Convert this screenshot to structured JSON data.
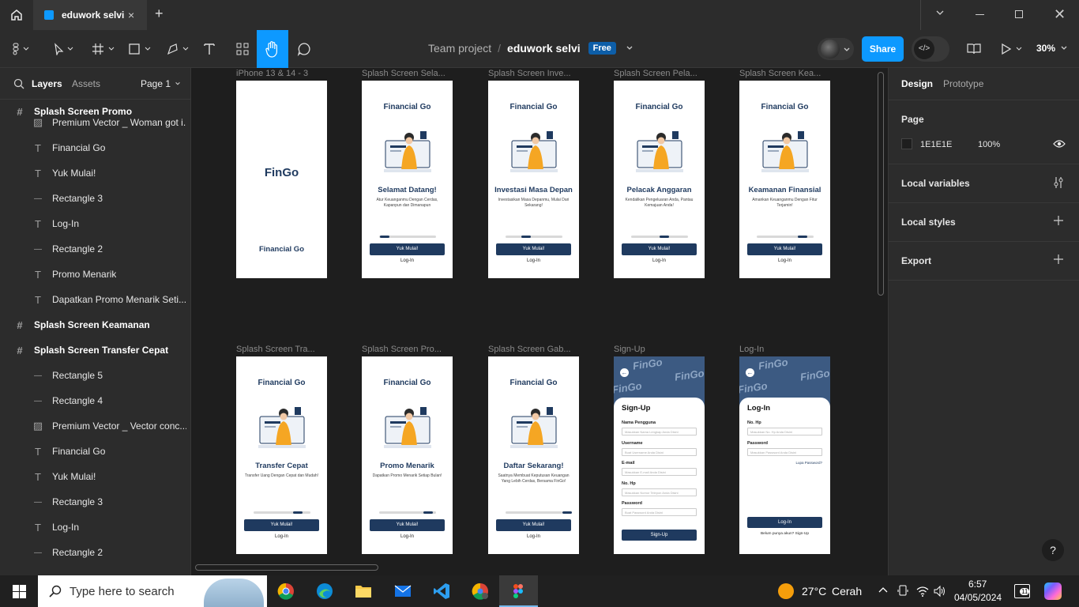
{
  "titlebar": {
    "tab_title": "eduwork selvi",
    "add_tab": "+"
  },
  "toolbar": {
    "breadcrumb_project": "Team project",
    "breadcrumb_sep": "/",
    "file_name": "eduwork selvi",
    "plan_badge": "Free",
    "share_label": "Share",
    "zoom": "30%"
  },
  "left_panel": {
    "tab_layers": "Layers",
    "tab_assets": "Assets",
    "page_select": "Page 1",
    "layers": [
      {
        "name": "Splash Screen Promo",
        "type": "frame",
        "level": 0
      },
      {
        "name": "Premium Vector _ Woman got i...",
        "type": "image",
        "level": 1
      },
      {
        "name": "Financial Go",
        "type": "text",
        "level": 1
      },
      {
        "name": "Yuk Mulai!",
        "type": "text",
        "level": 1
      },
      {
        "name": "Rectangle 3",
        "type": "rect",
        "level": 1
      },
      {
        "name": "Log-In",
        "type": "text",
        "level": 1
      },
      {
        "name": "Rectangle 2",
        "type": "rect",
        "level": 1
      },
      {
        "name": "Promo Menarik",
        "type": "text",
        "level": 1
      },
      {
        "name": "Dapatkan Promo Menarik Seti...",
        "type": "text",
        "level": 1
      },
      {
        "name": "Splash Screen Keamanan",
        "type": "frame",
        "level": 0
      },
      {
        "name": "Splash Screen Transfer Cepat",
        "type": "frame",
        "level": 0
      },
      {
        "name": "Rectangle 5",
        "type": "rect",
        "level": 1
      },
      {
        "name": "Rectangle 4",
        "type": "line",
        "level": 1
      },
      {
        "name": "Premium Vector _ Vector conc...",
        "type": "image",
        "level": 1
      },
      {
        "name": "Financial Go",
        "type": "text",
        "level": 1
      },
      {
        "name": "Yuk Mulai!",
        "type": "text",
        "level": 1
      },
      {
        "name": "Rectangle 3",
        "type": "rect",
        "level": 1
      },
      {
        "name": "Log-In",
        "type": "text",
        "level": 1
      },
      {
        "name": "Rectangle 2",
        "type": "rect",
        "level": 1
      }
    ]
  },
  "canvas": {
    "frames_row1": [
      {
        "label": "iPhone 13 & 14 - 3",
        "kind": "logo",
        "logo": "FinGo",
        "footer": "Financial Go"
      },
      {
        "label": "Splash Screen Sela...",
        "kind": "splash",
        "title": "Financial Go",
        "heading": "Selamat Datang!",
        "sub": "Atur Keuanganmu Dengan Cerdas, Kapanpun dan Dimanapun",
        "button": "Yuk Mulai!",
        "login": "Log-In",
        "progress": 0
      },
      {
        "label": "Splash Screen Inve...",
        "kind": "splash",
        "title": "Financial Go",
        "heading": "Investasi Masa Depan",
        "sub": "Investasikan Masa Depanmu, Mulai Dari Sekarang!",
        "button": "Yuk Mulai!",
        "login": "Log-In",
        "progress": 1
      },
      {
        "label": "Splash Screen Pela...",
        "kind": "splash",
        "title": "Financial Go",
        "heading": "Pelacak Anggaran",
        "sub": "Kendalikan Pengeluaran Anda, Pantau Kemajuan Anda!",
        "button": "Yuk Mulai!",
        "login": "Log-In",
        "progress": 2
      },
      {
        "label": "Splash Screen Kea...",
        "kind": "splash",
        "title": "Financial Go",
        "heading": "Keamanan Finansial",
        "sub": "Amankan Keuanganmu Dengan Fitur Terjamin!",
        "button": "Yuk Mulai!",
        "login": "Log-In",
        "progress": 3
      }
    ],
    "frames_row2": [
      {
        "label": "Splash Screen Tra...",
        "kind": "splash",
        "title": "Financial Go",
        "heading": "Transfer Cepat",
        "sub": "Transfer Uang Dengan Cepat dan Mudah!",
        "button": "Yuk Mulai!",
        "login": "Log-In",
        "progress": 4
      },
      {
        "label": "Splash Screen Pro...",
        "kind": "splash",
        "title": "Financial Go",
        "heading": "Promo Menarik",
        "sub": "Dapatkan Promo Menarik Setiap Bulan!",
        "button": "Yuk Mulai!",
        "login": "Log-In",
        "progress": 5
      },
      {
        "label": "Splash Screen Gab...",
        "kind": "splash",
        "title": "Financial Go",
        "heading": "Daftar Sekarang!",
        "sub": "Saatnya Membuat Keputusan Keuangan Yang Lebih Cerdas, Bersama FinGo!",
        "button": "Yuk Mulai!",
        "login": "Log-In",
        "progress": 6
      }
    ],
    "signup": {
      "label": "Sign-Up",
      "heading": "Sign-Up",
      "brand": "FinGo",
      "fields": [
        {
          "label": "Nama Pengguna",
          "placeholder": "Masukkan Nama Lengkap Anda Disini"
        },
        {
          "label": "Username",
          "placeholder": "Buat Username Anda Disini"
        },
        {
          "label": "E-mail",
          "placeholder": "Masukkan E-mail Anda Disini"
        },
        {
          "label": "No. Hp",
          "placeholder": "Masukkan Nomor Telepon Anda Disini"
        },
        {
          "label": "Password",
          "placeholder": "Buat Password Anda Disini"
        }
      ],
      "button": "Sign-Up"
    },
    "login": {
      "label": "Log-In",
      "heading": "Log-In",
      "brand": "FinGo",
      "fields": [
        {
          "label": "No. Hp",
          "placeholder": "Masukkan No. Hp Anda Disini"
        },
        {
          "label": "Password",
          "placeholder": "Masukkan Password Anda Disini"
        }
      ],
      "forgot": "Lupa Password?",
      "button": "Log-In",
      "footer": "Belum punya akun? Sign-Up"
    }
  },
  "right_panel": {
    "tab_design": "Design",
    "tab_prototype": "Prototype",
    "page_section": "Page",
    "page_color": "1E1E1E",
    "page_opacity": "100%",
    "local_variables": "Local variables",
    "local_styles": "Local styles",
    "export": "Export",
    "help": "?"
  },
  "taskbar": {
    "search_placeholder": "Type here to search",
    "weather_temp": "27°C",
    "weather_desc": "Cerah",
    "time": "6:57",
    "date": "04/05/2024",
    "notif_count": "11"
  },
  "colors": {
    "accent_blue": "#0d99ff",
    "brand_navy": "#1f3a5f",
    "panel_bg": "#2c2c2c",
    "canvas_bg": "#1e1e1e"
  }
}
